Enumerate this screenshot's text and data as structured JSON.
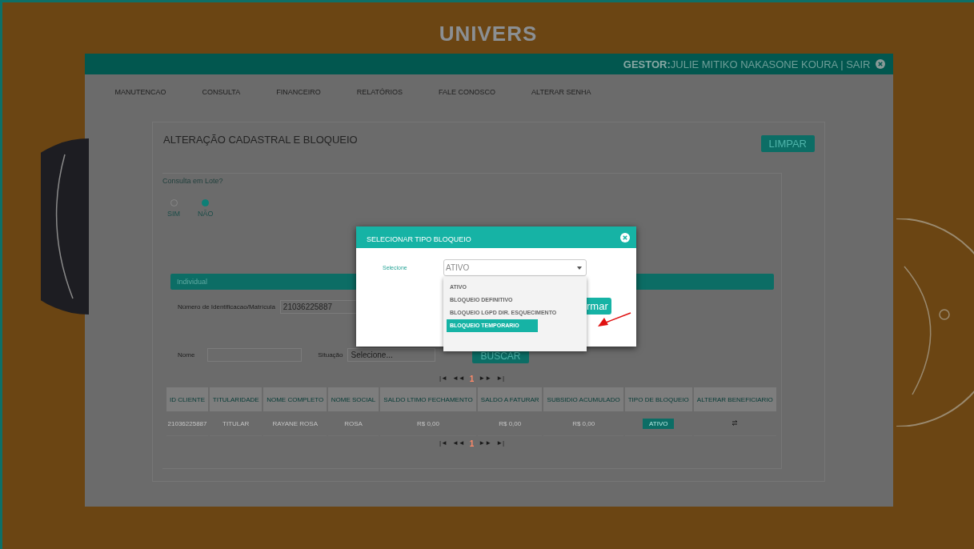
{
  "logo": "UNIVERS",
  "header": {
    "role": "GESTOR:",
    "user": "JULIE MITIKO NAKASONE KOURA | SAIR"
  },
  "nav": [
    {
      "label": "MANUTENCAO"
    },
    {
      "label": "CONSULTA"
    },
    {
      "label": "FINANCEIRO"
    },
    {
      "label": "RELATÓRIOS"
    },
    {
      "label": "FALE CONOSCO"
    },
    {
      "label": "ALTERAR SENHA"
    }
  ],
  "page": {
    "title": "ALTERAÇÃO CADASTRAL E BLOQUEIO",
    "clear_button": "LIMPAR"
  },
  "batch": {
    "question": "Consulta em Lote?",
    "options": [
      {
        "label": "SIM",
        "selected": false
      },
      {
        "label": "NÃO",
        "selected": true
      }
    ]
  },
  "individual": {
    "title": "Individual",
    "id_label": "Número de Identificacao/Matrícula",
    "id_value": "21036225887",
    "name_label": "Nome",
    "status_label": "Situação",
    "status_placeholder": "Selecione...",
    "search_button": "BUSCAR"
  },
  "pager_top": [
    {
      "text": "|◄",
      "selected": false
    },
    {
      "text": "◄◄",
      "selected": false
    },
    {
      "text": "1",
      "selected": true
    },
    {
      "text": "►►",
      "selected": false
    },
    {
      "text": "►|",
      "selected": false
    }
  ],
  "pager_bottom": [
    {
      "text": "|◄",
      "selected": false
    },
    {
      "text": "◄◄",
      "selected": false
    },
    {
      "text": "1",
      "selected": true
    },
    {
      "text": "►►",
      "selected": false
    },
    {
      "text": "►|",
      "selected": false
    }
  ],
  "table": {
    "columns": [
      "ID CLIENTE",
      "TITULARIDADE",
      "NOME COMPLETO",
      "NOME SOCIAL",
      "SALDO LTIMO FECHAMENTO",
      "SALDO A FATURAR",
      "SUBSIDIO ACUMULADO",
      "TIPO DE BLOQUEIO",
      "ALTERAR BENEFICIARIO"
    ],
    "rows": [
      [
        {
          "kind": "text",
          "text": "21036225887"
        },
        {
          "kind": "text",
          "text": "TITULAR"
        },
        {
          "kind": "text",
          "text": "RAYANE ROSA"
        },
        {
          "kind": "text",
          "text": "ROSA"
        },
        {
          "kind": "text",
          "text": "R$ 0,00"
        },
        {
          "kind": "text",
          "text": "R$ 0,00"
        },
        {
          "kind": "text",
          "text": "R$ 0,00"
        },
        {
          "kind": "badge",
          "text": "ATIVO"
        },
        {
          "kind": "icon"
        }
      ]
    ]
  },
  "modal": {
    "title": "SELECIONAR TIPO BLOQUEIO",
    "field_label": "Selecione",
    "value": "ATIVO",
    "confirm_partial": "rmar",
    "options": [
      {
        "label": "ATIVO",
        "highlighted": false
      },
      {
        "label": "BLOQUEIO DEFINITIVO",
        "highlighted": false
      },
      {
        "label": "BLOQUEIO LGPD DIR. ESQUECIMENTO",
        "highlighted": false
      },
      {
        "label": "BLOQUEIO TEMPORARIO",
        "highlighted": true
      }
    ]
  }
}
